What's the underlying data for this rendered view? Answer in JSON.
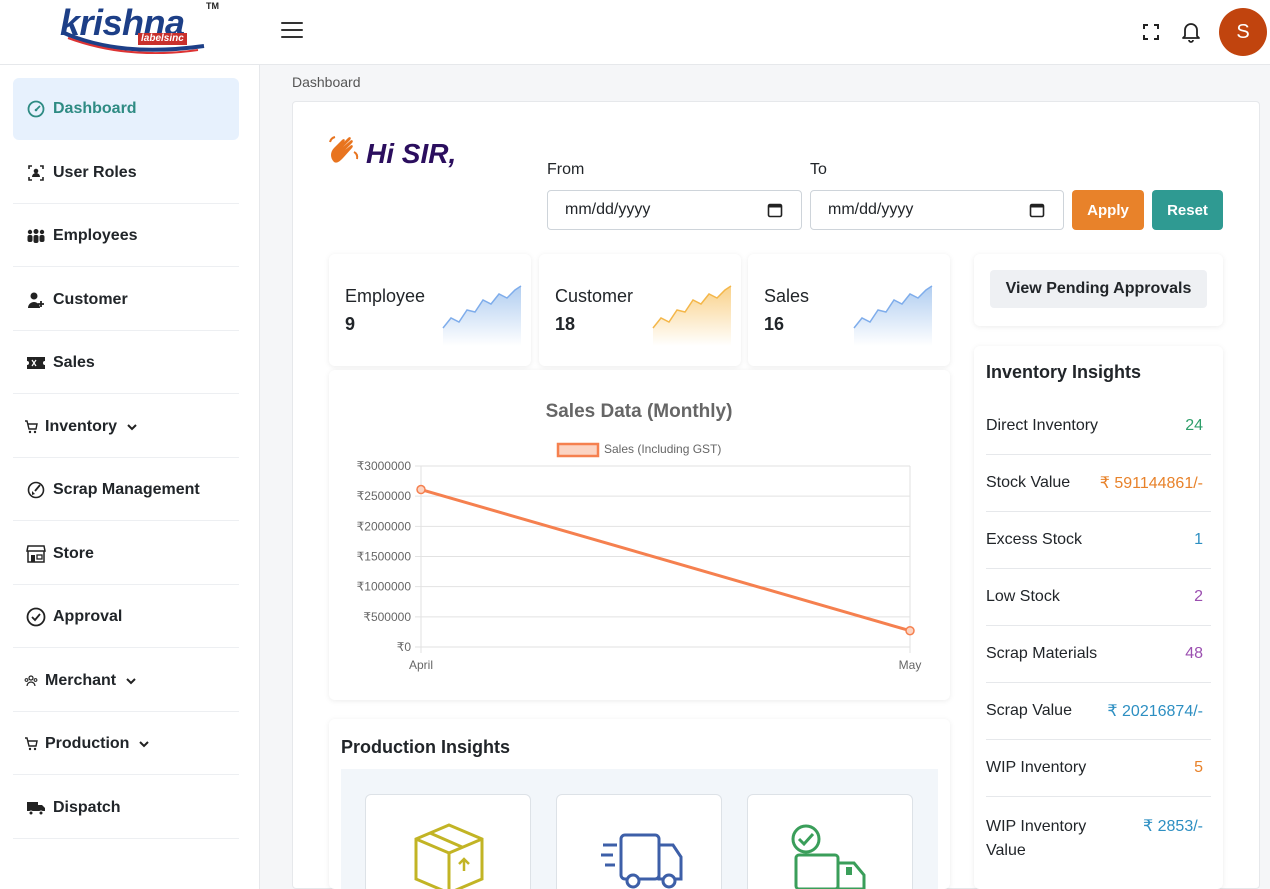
{
  "brand": {
    "name": "krishna",
    "sub": "labelsinc",
    "tm": "TM"
  },
  "user": {
    "initial": "S"
  },
  "sidebar": {
    "items": [
      {
        "label": "Dashboard",
        "icon": "gauge-icon",
        "active": true
      },
      {
        "label": "User Roles",
        "icon": "user-roles-icon"
      },
      {
        "label": "Employees",
        "icon": "people-icon"
      },
      {
        "label": "Customer",
        "icon": "user-plus-icon"
      },
      {
        "label": "Sales",
        "icon": "ticket-icon"
      },
      {
        "label": "Inventory",
        "icon": "cart-icon",
        "dropdown": true
      },
      {
        "label": "Scrap Management",
        "icon": "broom-icon"
      },
      {
        "label": "Store",
        "icon": "store-icon"
      },
      {
        "label": "Approval",
        "icon": "check-circle-icon"
      },
      {
        "label": "Merchant",
        "icon": "group-icon",
        "dropdown": true
      },
      {
        "label": "Production",
        "icon": "cart-icon",
        "dropdown": true
      },
      {
        "label": "Dispatch",
        "icon": "truck-icon"
      }
    ]
  },
  "breadcrumb": "Dashboard",
  "greeting": "Hi SIR,",
  "filter": {
    "from_label": "From",
    "to_label": "To",
    "from_value": "mm/dd/yyyy",
    "to_value": "mm/dd/yyyy",
    "apply": "Apply",
    "reset": "Reset"
  },
  "stats": [
    {
      "title": "Employee",
      "value": "9",
      "color": "#a8c8ef"
    },
    {
      "title": "Customer",
      "value": "18",
      "color": "#f9cf83"
    },
    {
      "title": "Sales",
      "value": "16",
      "color": "#a8c8ef"
    }
  ],
  "colors": {
    "accent": "#2e8b83",
    "apply": "#e8822a",
    "reset": "#2f9a92",
    "line": "#f5804f"
  },
  "chart_data": {
    "type": "line",
    "title": "Sales Data (Monthly)",
    "categories": [
      "April",
      "May"
    ],
    "series": [
      {
        "name": "Sales (Including GST)",
        "values": [
          2610000,
          270000
        ]
      }
    ],
    "ylim": [
      0,
      3000000
    ],
    "yticks": [
      "₹3000000",
      "₹2500000",
      "₹2000000",
      "₹1500000",
      "₹1000000",
      "₹500000",
      "₹0"
    ],
    "grid": true,
    "legend": "top"
  },
  "production": {
    "title": "Production Insights"
  },
  "approvals": {
    "label": "View Pending Approvals"
  },
  "inventory": {
    "title": "Inventory Insights",
    "rows": [
      {
        "label": "Direct Inventory",
        "value": "24",
        "color": "#2e9e6a"
      },
      {
        "label": "Stock Value",
        "value": "₹ 591144861/-",
        "color": "#e8822a"
      },
      {
        "label": "Excess Stock",
        "value": "1",
        "color": "#2d8fc2"
      },
      {
        "label": "Low Stock",
        "value": "2",
        "color": "#9b4fb0"
      },
      {
        "label": "Scrap Materials",
        "value": "48",
        "color": "#9b4fb0"
      },
      {
        "label": "Scrap Value",
        "value": "₹ 20216874/-",
        "color": "#2d8fc2"
      },
      {
        "label": "WIP Inventory",
        "value": "5",
        "color": "#e8822a"
      },
      {
        "label": "WIP Inventory Value",
        "value": "₹ 2853/-",
        "color": "#2d8fc2"
      }
    ]
  }
}
